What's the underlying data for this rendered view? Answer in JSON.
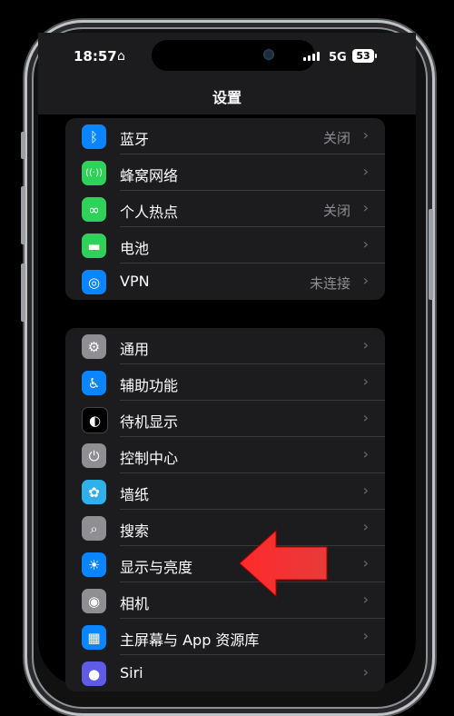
{
  "status": {
    "time": "18:57",
    "network": "5G",
    "battery": "53"
  },
  "nav": {
    "title": "设置"
  },
  "group1": [
    {
      "label": "蓝牙",
      "value": "关闭",
      "icon": "bluetooth-icon",
      "color": "#0a84ff",
      "glyph": "ᛒ"
    },
    {
      "label": "蜂窝网络",
      "value": "",
      "icon": "cellular-icon",
      "color": "#30d158",
      "glyph": "((·))"
    },
    {
      "label": "个人热点",
      "value": "关闭",
      "icon": "hotspot-icon",
      "color": "#30d158",
      "glyph": "∞"
    },
    {
      "label": "电池",
      "value": "",
      "icon": "battery-icon",
      "color": "#30d158",
      "glyph": "▬"
    },
    {
      "label": "VPN",
      "value": "未连接",
      "icon": "vpn-icon",
      "color": "#0a84ff",
      "glyph": "◎"
    }
  ],
  "group2": [
    {
      "label": "通用",
      "icon": "gear-icon",
      "color": "#8e8e93",
      "glyph": "⚙"
    },
    {
      "label": "辅助功能",
      "icon": "accessibility-icon",
      "color": "#0a84ff",
      "glyph": "♿"
    },
    {
      "label": "待机显示",
      "icon": "standby-icon",
      "color": "#000000",
      "glyph": "◐"
    },
    {
      "label": "控制中心",
      "icon": "control-center-icon",
      "color": "#8e8e93",
      "glyph": "⏻"
    },
    {
      "label": "墙纸",
      "icon": "wallpaper-icon",
      "color": "#30b0e8",
      "glyph": "✿"
    },
    {
      "label": "搜索",
      "icon": "search-icon",
      "color": "#8e8e93",
      "glyph": "⌕"
    },
    {
      "label": "显示与亮度",
      "icon": "brightness-icon",
      "color": "#0a84ff",
      "glyph": "☀"
    },
    {
      "label": "相机",
      "icon": "camera-icon",
      "color": "#8e8e93",
      "glyph": "◉"
    },
    {
      "label": "主屏幕与 App 资源库",
      "icon": "home-screen-icon",
      "color": "#0a84ff",
      "glyph": "▦"
    },
    {
      "label": "Siri",
      "icon": "siri-icon",
      "color": "#5e5ce6",
      "glyph": "●"
    }
  ]
}
